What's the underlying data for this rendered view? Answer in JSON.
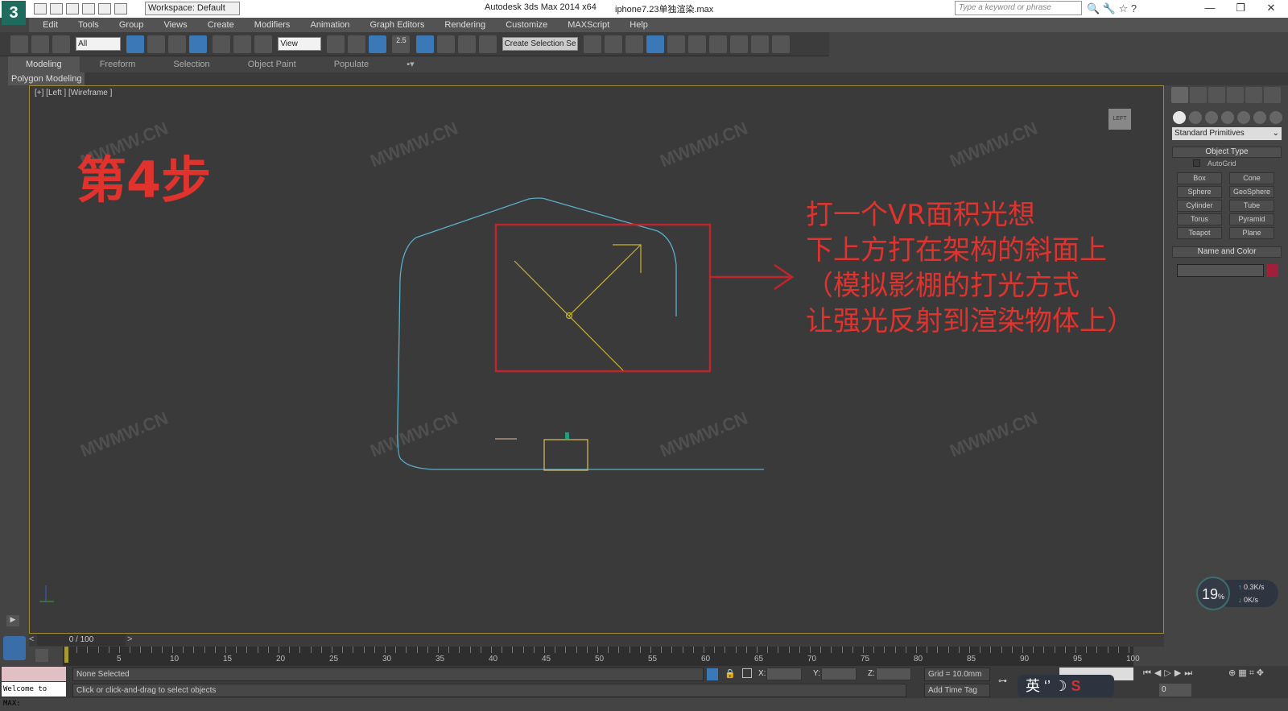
{
  "app": {
    "title": "Autodesk 3ds Max  2014 x64",
    "file": "iphone7.23单独渲染.max",
    "workspace": "Workspace: Default",
    "search_placeholder": "Type a keyword or phrase",
    "logo": "3ds Max logo"
  },
  "window": {
    "minimize": "—",
    "restore": "❐",
    "close": "✕"
  },
  "menu": [
    "Edit",
    "Tools",
    "Group",
    "Views",
    "Create",
    "Modifiers",
    "Animation",
    "Graph Editors",
    "Rendering",
    "Customize",
    "MAXScript",
    "Help"
  ],
  "toolbar": {
    "filter": "All",
    "ref_coord": "View",
    "snap_value": "2.5",
    "selection_set": "Create Selection Se"
  },
  "ribbon": {
    "tabs": [
      "Modeling",
      "Freeform",
      "Selection",
      "Object Paint",
      "Populate"
    ],
    "panel": "Polygon Modeling"
  },
  "viewport": {
    "label": "[+] [Left ] [Wireframe ]",
    "step": "第4步",
    "annotation": [
      "打一个VR面积光想",
      "下上方打在架构的斜面上",
      "（模拟影棚的打光方式",
      "让强光反射到渲染物体上）"
    ],
    "watermark": "MWMW.CN",
    "viewcube": "LEFT",
    "annotation_color": "#e0332e"
  },
  "command_panel": {
    "category": "Standard Primitives",
    "object_type": "Object Type",
    "autogrid": "AutoGrid",
    "buttons": [
      "Box",
      "Cone",
      "Sphere",
      "GeoSphere",
      "Cylinder",
      "Tube",
      "Torus",
      "Pyramid",
      "Teapot",
      "Plane"
    ],
    "name_and_color": "Name and Color",
    "object_color": "#a0203a"
  },
  "speed": {
    "cpu": "19",
    "unit": "%",
    "up": "0.3K/s",
    "down": "0K/s"
  },
  "timeline": {
    "slider": "0 / 100",
    "ticks": [
      "5",
      "10",
      "15",
      "20",
      "25",
      "30",
      "35",
      "40",
      "45",
      "50",
      "55",
      "60",
      "65",
      "70",
      "75",
      "80",
      "85",
      "90",
      "95",
      "100"
    ]
  },
  "status": {
    "welcome": "Welcome to MAX:",
    "selection": "None Selected",
    "prompt": "Click or click-and-drag to select objects",
    "x_label": "X:",
    "y_label": "Y:",
    "z_label": "Z:",
    "grid": "Grid = 10.0mm",
    "add_time_tag": "Add Time Tag",
    "frame": "0",
    "ime": "英"
  }
}
